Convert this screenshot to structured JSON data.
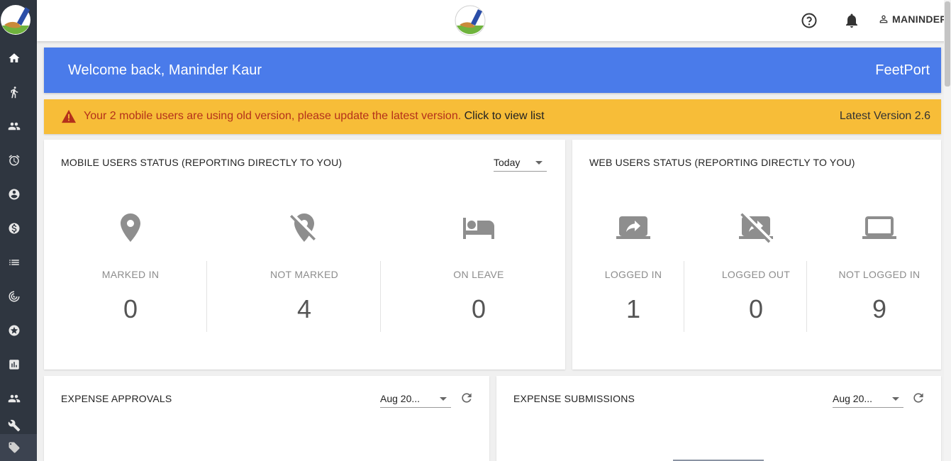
{
  "header": {
    "user_name": "MANINDER"
  },
  "welcome": {
    "title": "Welcome back, Maninder Kaur",
    "brand": "FeetPort"
  },
  "alert": {
    "message": "Your 2 mobile users are using old version, please update the latest version.",
    "link": "Click to view list",
    "version": "Latest Version 2.6",
    "color": "#f7bd38"
  },
  "mobile_status": {
    "title": "MOBILE USERS STATUS (REPORTING DIRECTLY TO YOU)",
    "filter": "Today",
    "stats": [
      {
        "label": "MARKED IN",
        "value": "0",
        "icon": "location-pin-icon"
      },
      {
        "label": "NOT MARKED",
        "value": "4",
        "icon": "location-off-icon"
      },
      {
        "label": "ON LEAVE",
        "value": "0",
        "icon": "bed-icon"
      }
    ]
  },
  "web_status": {
    "title": "WEB USERS STATUS (REPORTING DIRECTLY TO YOU)",
    "stats": [
      {
        "label": "LOGGED IN",
        "value": "1",
        "icon": "screen-share-icon"
      },
      {
        "label": "LOGGED OUT",
        "value": "0",
        "icon": "stop-screen-share-icon"
      },
      {
        "label": "NOT LOGGED IN",
        "value": "9",
        "icon": "laptop-icon"
      }
    ]
  },
  "expense_approvals": {
    "title": "EXPENSE APPROVALS",
    "filter": "Aug 20..."
  },
  "expense_submissions": {
    "title": "EXPENSE SUBMISSIONS",
    "filter": "Aug 20..."
  },
  "theme": {
    "sidebar": "#2f3640",
    "banner": "#4a7bea"
  }
}
